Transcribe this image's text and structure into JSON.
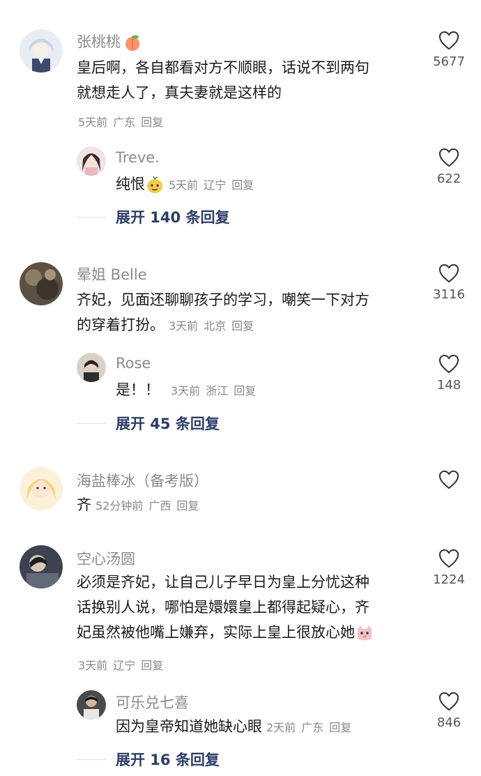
{
  "comments": [
    {
      "username": "张桃桃",
      "text_lines": [
        "皇后啊，各自都看对方不顺眼，话说不到两句",
        "就想走人了，真夫妻就是这样的"
      ],
      "time": "5天前",
      "location": "广东",
      "reply_label": "回复",
      "likes": "5677",
      "username_emoji": "peach-emoji",
      "reply": {
        "username": "Treve.",
        "text": "纯恨",
        "emoji": "mango-face-emoji",
        "time": "5天前",
        "location": "辽宁",
        "reply_label": "回复",
        "likes": "622"
      },
      "expand_label": "展开 140 条回复"
    },
    {
      "username": "晕姐 Belle",
      "text_lines": [
        "齐妃，见面还聊聊孩子的学习，嘲笑一下对方",
        "的穿着打扮。"
      ],
      "time": "3天前",
      "location": "北京",
      "reply_label": "回复",
      "likes": "3116",
      "reply": {
        "username": "Rose",
        "text": "是！！",
        "time": "3天前",
        "location": "浙江",
        "reply_label": "回复",
        "likes": "148"
      },
      "expand_label": "展开 45 条回复"
    },
    {
      "username": "海盐棒冰（备考版）",
      "text": "齐",
      "time": "52分钟前",
      "location": "广西",
      "reply_label": "回复",
      "likes": ""
    },
    {
      "username": "空心汤圆",
      "text_lines": [
        "必须是齐妃，让自己儿子早日为皇上分忧这种",
        "话换别人说，哪怕是嬛嬛皇上都得起疑心，齐",
        "妃虽然被他嘴上嫌弃，实际上皇上很放心她"
      ],
      "text_emoji": "cat-emoji",
      "time": "3天前",
      "location": "辽宁",
      "reply_label": "回复",
      "likes": "1224",
      "reply": {
        "username": "可乐兑七喜",
        "text": "因为皇帝知道她缺心眼",
        "time": "2天前",
        "location": "广东",
        "reply_label": "回复",
        "likes": "846"
      },
      "expand_label": "展开 16 条回复"
    }
  ],
  "colors": {
    "username": "#8a8a8a",
    "body_text": "#1a1a1a",
    "meta": "#888888",
    "expand": "#2c3e66"
  }
}
